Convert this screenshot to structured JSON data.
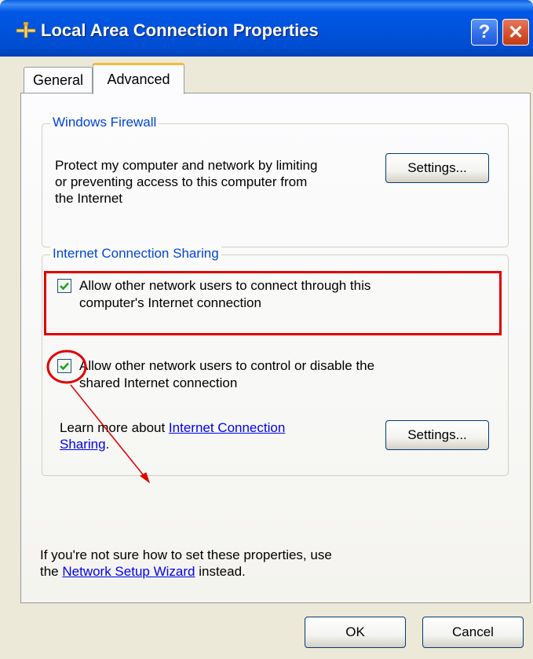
{
  "window": {
    "title": "Local Area Connection Properties",
    "help_label": "?",
    "close_label": "✕"
  },
  "tabs": [
    {
      "label": "General",
      "selected": false
    },
    {
      "label": "Advanced",
      "selected": true
    }
  ],
  "firewall": {
    "legend": "Windows Firewall",
    "description": "Protect my computer and network by limiting or preventing access to this computer from the Internet",
    "line1": "Protect my computer and network by limiting",
    "line2": "or preventing access to this computer from",
    "line3": "the Internet",
    "settings_label": "Settings..."
  },
  "ics": {
    "legend": "Internet Connection Sharing",
    "allow_connect": {
      "line1": "Allow other network users to connect through this",
      "line2": "computer's Internet connection",
      "checked": true
    },
    "allow_control": {
      "line1": "Allow other network users to control or disable the",
      "line2": "shared Internet connection",
      "checked": true
    },
    "learn_more_prefix": "Learn more about ",
    "learn_more_link1": "Internet Connection",
    "learn_more_link2": "Sharing",
    "learn_more_suffix": ".",
    "settings_label": "Settings..."
  },
  "footer": {
    "line1": "If you're not sure how to set these properties, use",
    "line2_prefix": "the ",
    "wizard_link": "Network Setup Wizard",
    "line2_suffix": " instead."
  },
  "buttons": {
    "ok": "OK",
    "cancel": "Cancel"
  },
  "colors": {
    "title_bar": "#0054e3",
    "legend_text": "#0046d5",
    "annotation": "#e00000",
    "checkmark": "#21a121",
    "tab_highlight": "#f5b93b"
  }
}
